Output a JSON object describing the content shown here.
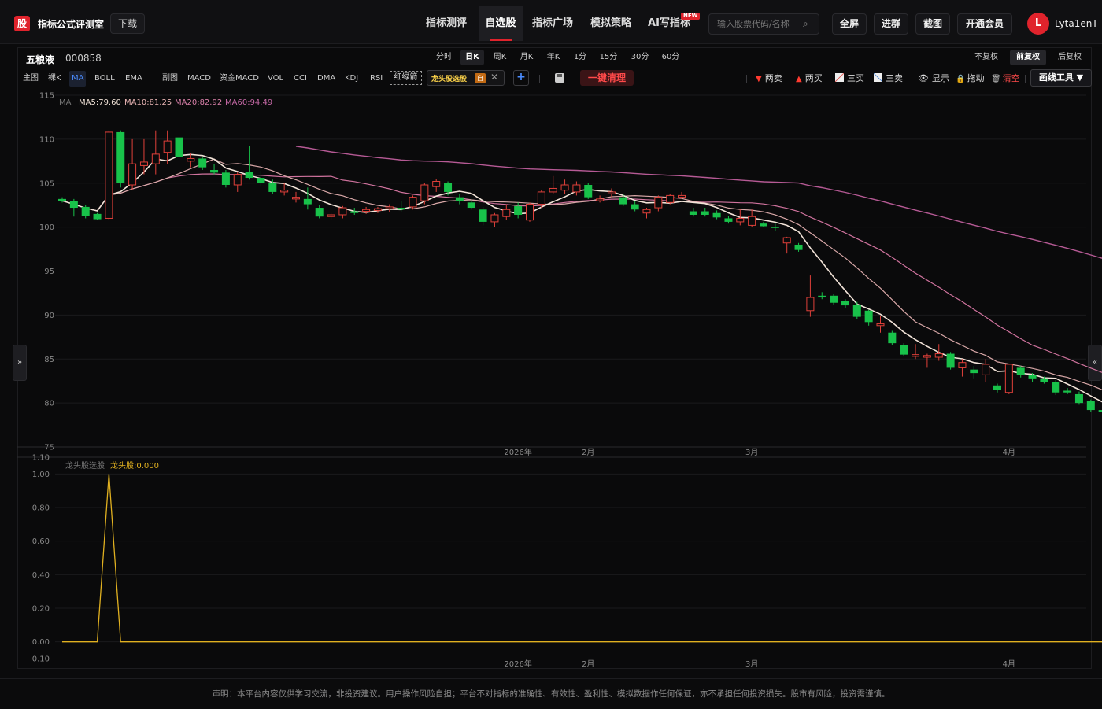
{
  "app": {
    "logo": "股",
    "name": "指标公式评测室",
    "download": "下载"
  },
  "nav": [
    {
      "label": "指标测评",
      "active": false
    },
    {
      "label": "自选股",
      "active": true
    },
    {
      "label": "指标广场",
      "active": false
    },
    {
      "label": "模拟策略",
      "active": false
    },
    {
      "label": "AI写指标",
      "active": false,
      "badge": "NEW"
    }
  ],
  "search": {
    "placeholder": "输入股票代码/名称"
  },
  "top_buttons": [
    "全屏",
    "进群",
    "截图",
    "开通会员"
  ],
  "user": {
    "initial": "L",
    "name": "Lyta1enT"
  },
  "stock": {
    "name": "五粮液",
    "code": "000858"
  },
  "periods": [
    {
      "label": "分时",
      "active": false
    },
    {
      "label": "日K",
      "active": true
    },
    {
      "label": "周K",
      "active": false
    },
    {
      "label": "月K",
      "active": false
    },
    {
      "label": "年K",
      "active": false
    },
    {
      "label": "1分",
      "active": false
    },
    {
      "label": "15分",
      "active": false
    },
    {
      "label": "30分",
      "active": false
    },
    {
      "label": "60分",
      "active": false
    }
  ],
  "adjust": [
    {
      "label": "不复权",
      "active": false
    },
    {
      "label": "前复权",
      "active": true
    },
    {
      "label": "后复权",
      "active": false
    }
  ],
  "indicators_main": [
    {
      "label": "主图",
      "active": false
    },
    {
      "label": "裸K",
      "active": false
    },
    {
      "label": "MA",
      "active": true
    },
    {
      "label": "BOLL",
      "active": false
    },
    {
      "label": "EMA",
      "active": false
    }
  ],
  "indicators_sub": [
    "副图",
    "MACD",
    "资金MACD",
    "VOL",
    "CCI",
    "DMA",
    "KDJ",
    "RSI"
  ],
  "highlight_tag": "红绿箭",
  "active_indicator": {
    "label": "龙头股选股",
    "self_tag": "自"
  },
  "clean_button": "一键清理",
  "tools": [
    {
      "icon": "down-triangle-icon",
      "label": "两卖",
      "color": "#ff3b30"
    },
    {
      "icon": "up-triangle-icon",
      "label": "两买",
      "color": "#ff3b30"
    },
    {
      "icon": "three-buy-icon",
      "label": "三买",
      "color": "#dddddd"
    },
    {
      "icon": "three-sell-icon",
      "label": "三卖",
      "color": "#dddddd"
    },
    {
      "icon": "eye-icon",
      "label": "显示",
      "color": "#dddddd"
    },
    {
      "icon": "lock-icon",
      "label": "拖动",
      "color": "#dddddd"
    },
    {
      "icon": "trash-icon",
      "label": "清空",
      "color": "#ff4a4a"
    }
  ],
  "draw_tools": "画线工具 ▼",
  "side_left": "»",
  "side_right": "«",
  "ma_legend": {
    "title": "MA",
    "items": [
      {
        "label": "MA5:79.60",
        "color": "#f2e3d8"
      },
      {
        "label": "MA10:81.25",
        "color": "#e8b4b4"
      },
      {
        "label": "MA20:82.92",
        "color": "#d77fa8"
      },
      {
        "label": "MA60:94.49",
        "color": "#c86aa8"
      }
    ]
  },
  "sub_legend": {
    "name": "龙头股选股",
    "value": "龙头股:0.000",
    "color": "#e0b020"
  },
  "colors": {
    "up": "#e0403a",
    "down": "#18c24a",
    "sub_line": "#e0b020"
  },
  "footer": "声明：本平台内容仅供学习交流，非投资建议。用户操作风险自担；平台不对指标的准确性、有效性、盈利性、模拟数据作任何保证，亦不承担任何投资损失。股市有风险，投资需谨慎。",
  "chart_data": [
    {
      "type": "candlestick",
      "title": "",
      "ylim": [
        75,
        115
      ],
      "yticks": [
        75,
        80,
        85,
        90,
        95,
        100,
        105,
        110,
        115
      ],
      "xticks": [
        {
          "label": "2026年",
          "index": 39
        },
        {
          "label": "2月",
          "index": 45
        },
        {
          "label": "3月",
          "index": 59
        },
        {
          "label": "4月",
          "index": 81
        }
      ],
      "candles": [
        [
          103.2,
          103.4,
          102.8,
          103.0
        ],
        [
          103.0,
          103.2,
          101.2,
          102.2
        ],
        [
          102.3,
          102.5,
          101.0,
          101.3
        ],
        [
          101.5,
          101.6,
          100.8,
          100.9
        ],
        [
          101.0,
          111.0,
          100.8,
          110.8
        ],
        [
          110.8,
          111.0,
          104.5,
          105.0
        ],
        [
          104.8,
          110.0,
          104.2,
          107.2
        ],
        [
          107.0,
          110.0,
          106.0,
          107.4
        ],
        [
          107.2,
          111.0,
          106.0,
          108.3
        ],
        [
          108.5,
          111.0,
          107.2,
          109.8
        ],
        [
          110.2,
          110.5,
          107.8,
          108.0
        ],
        [
          107.5,
          108.4,
          106.8,
          107.8
        ],
        [
          107.8,
          108.0,
          106.5,
          106.8
        ],
        [
          106.5,
          107.2,
          106.0,
          106.2
        ],
        [
          106.2,
          106.5,
          104.5,
          104.8
        ],
        [
          104.8,
          106.3,
          104.0,
          106.0
        ],
        [
          106.3,
          109.2,
          105.4,
          105.6
        ],
        [
          105.6,
          106.4,
          104.6,
          105.0
        ],
        [
          105.0,
          105.4,
          103.8,
          104.0
        ],
        [
          104.0,
          105.0,
          103.6,
          104.2
        ],
        [
          103.2,
          104.0,
          102.8,
          103.4
        ],
        [
          103.2,
          104.5,
          102.0,
          102.6
        ],
        [
          102.2,
          102.5,
          101.0,
          101.2
        ],
        [
          101.2,
          101.6,
          100.9,
          101.4
        ],
        [
          101.4,
          102.4,
          101.0,
          102.2
        ],
        [
          101.8,
          102.2,
          101.4,
          101.6
        ],
        [
          101.8,
          102.3,
          101.5,
          102.0
        ],
        [
          101.9,
          102.3,
          101.6,
          102.1
        ],
        [
          102.1,
          102.6,
          101.7,
          102.3
        ],
        [
          102.2,
          103.0,
          101.8,
          102.0
        ],
        [
          102.3,
          103.6,
          102.0,
          103.4
        ],
        [
          103.0,
          105.0,
          102.6,
          104.8
        ],
        [
          104.6,
          105.5,
          104.0,
          105.2
        ],
        [
          105.0,
          105.2,
          103.6,
          104.0
        ],
        [
          103.4,
          103.8,
          102.6,
          103.0
        ],
        [
          102.8,
          103.2,
          102.0,
          102.2
        ],
        [
          102.0,
          102.3,
          100.2,
          100.6
        ],
        [
          100.6,
          101.6,
          100.0,
          101.4
        ],
        [
          101.2,
          102.6,
          100.8,
          102.0
        ],
        [
          102.4,
          102.8,
          101.0,
          101.4
        ],
        [
          100.8,
          102.8,
          100.6,
          102.6
        ],
        [
          102.6,
          104.2,
          102.2,
          104.0
        ],
        [
          104.0,
          105.8,
          103.8,
          104.4
        ],
        [
          104.2,
          105.4,
          103.8,
          104.8
        ],
        [
          104.0,
          105.2,
          103.6,
          104.8
        ],
        [
          104.8,
          105.0,
          103.2,
          103.4
        ],
        [
          103.0,
          103.6,
          102.8,
          103.2
        ],
        [
          103.8,
          104.4,
          103.4,
          104.0
        ],
        [
          103.4,
          103.8,
          102.4,
          102.6
        ],
        [
          102.6,
          103.0,
          101.8,
          102.0
        ],
        [
          101.6,
          102.2,
          101.0,
          102.0
        ],
        [
          102.2,
          103.6,
          101.8,
          103.4
        ],
        [
          102.8,
          103.8,
          102.6,
          103.6
        ],
        [
          103.4,
          104.0,
          103.2,
          103.6
        ],
        [
          101.8,
          102.2,
          101.2,
          101.4
        ],
        [
          101.8,
          102.2,
          101.2,
          101.4
        ],
        [
          101.6,
          101.9,
          100.9,
          101.1
        ],
        [
          101.0,
          101.3,
          100.4,
          100.6
        ],
        [
          100.6,
          102.0,
          100.2,
          101.0
        ],
        [
          100.2,
          102.0,
          100.0,
          101.2
        ],
        [
          100.4,
          100.6,
          100.0,
          100.1
        ],
        [
          100.0,
          100.4,
          99.6,
          99.9
        ],
        [
          98.2,
          98.9,
          97.0,
          98.8
        ],
        [
          98.0,
          98.2,
          97.2,
          97.4
        ],
        [
          90.5,
          94.5,
          89.8,
          92.0
        ],
        [
          92.2,
          92.6,
          91.8,
          92.0
        ],
        [
          92.2,
          92.4,
          91.2,
          91.4
        ],
        [
          91.6,
          91.8,
          90.8,
          91.1
        ],
        [
          91.2,
          91.5,
          89.5,
          89.8
        ],
        [
          90.5,
          90.6,
          88.8,
          89.2
        ],
        [
          88.8,
          89.9,
          88.0,
          89.0
        ],
        [
          88.0,
          88.2,
          86.6,
          86.8
        ],
        [
          86.6,
          86.8,
          85.3,
          85.5
        ],
        [
          85.3,
          86.7,
          85.0,
          85.5
        ],
        [
          85.2,
          85.6,
          84.0,
          85.4
        ],
        [
          85.2,
          86.7,
          84.8,
          85.6
        ],
        [
          85.6,
          85.8,
          83.8,
          84.0
        ],
        [
          84.0,
          85.0,
          83.0,
          84.6
        ],
        [
          83.8,
          84.2,
          82.8,
          83.4
        ],
        [
          83.2,
          85.0,
          82.4,
          84.4
        ],
        [
          82.0,
          82.2,
          81.2,
          81.5
        ],
        [
          81.2,
          84.4,
          81.0,
          84.4
        ],
        [
          84.0,
          84.2,
          82.9,
          83.2
        ],
        [
          83.2,
          83.4,
          82.4,
          82.8
        ],
        [
          82.8,
          83.0,
          82.2,
          82.4
        ],
        [
          82.4,
          82.6,
          80.9,
          81.2
        ],
        [
          81.4,
          81.7,
          81.0,
          81.2
        ],
        [
          81.0,
          81.3,
          79.8,
          80.0
        ],
        [
          80.2,
          80.4,
          79.0,
          79.2
        ],
        [
          79.2,
          79.6,
          78.8,
          79.0
        ],
        [
          79.2,
          79.8,
          77.8,
          78.8
        ]
      ]
    },
    {
      "type": "line",
      "title": "",
      "ylim": [
        -0.1,
        1.1
      ],
      "yticks": [
        -0.1,
        0.0,
        0.2,
        0.4,
        0.6,
        0.8,
        1.0,
        1.1
      ],
      "series": [
        {
          "name": "龙头股",
          "spike_index": 4,
          "spike_value": 1.0,
          "base_value": 0.0,
          "count": 91
        }
      ]
    }
  ]
}
